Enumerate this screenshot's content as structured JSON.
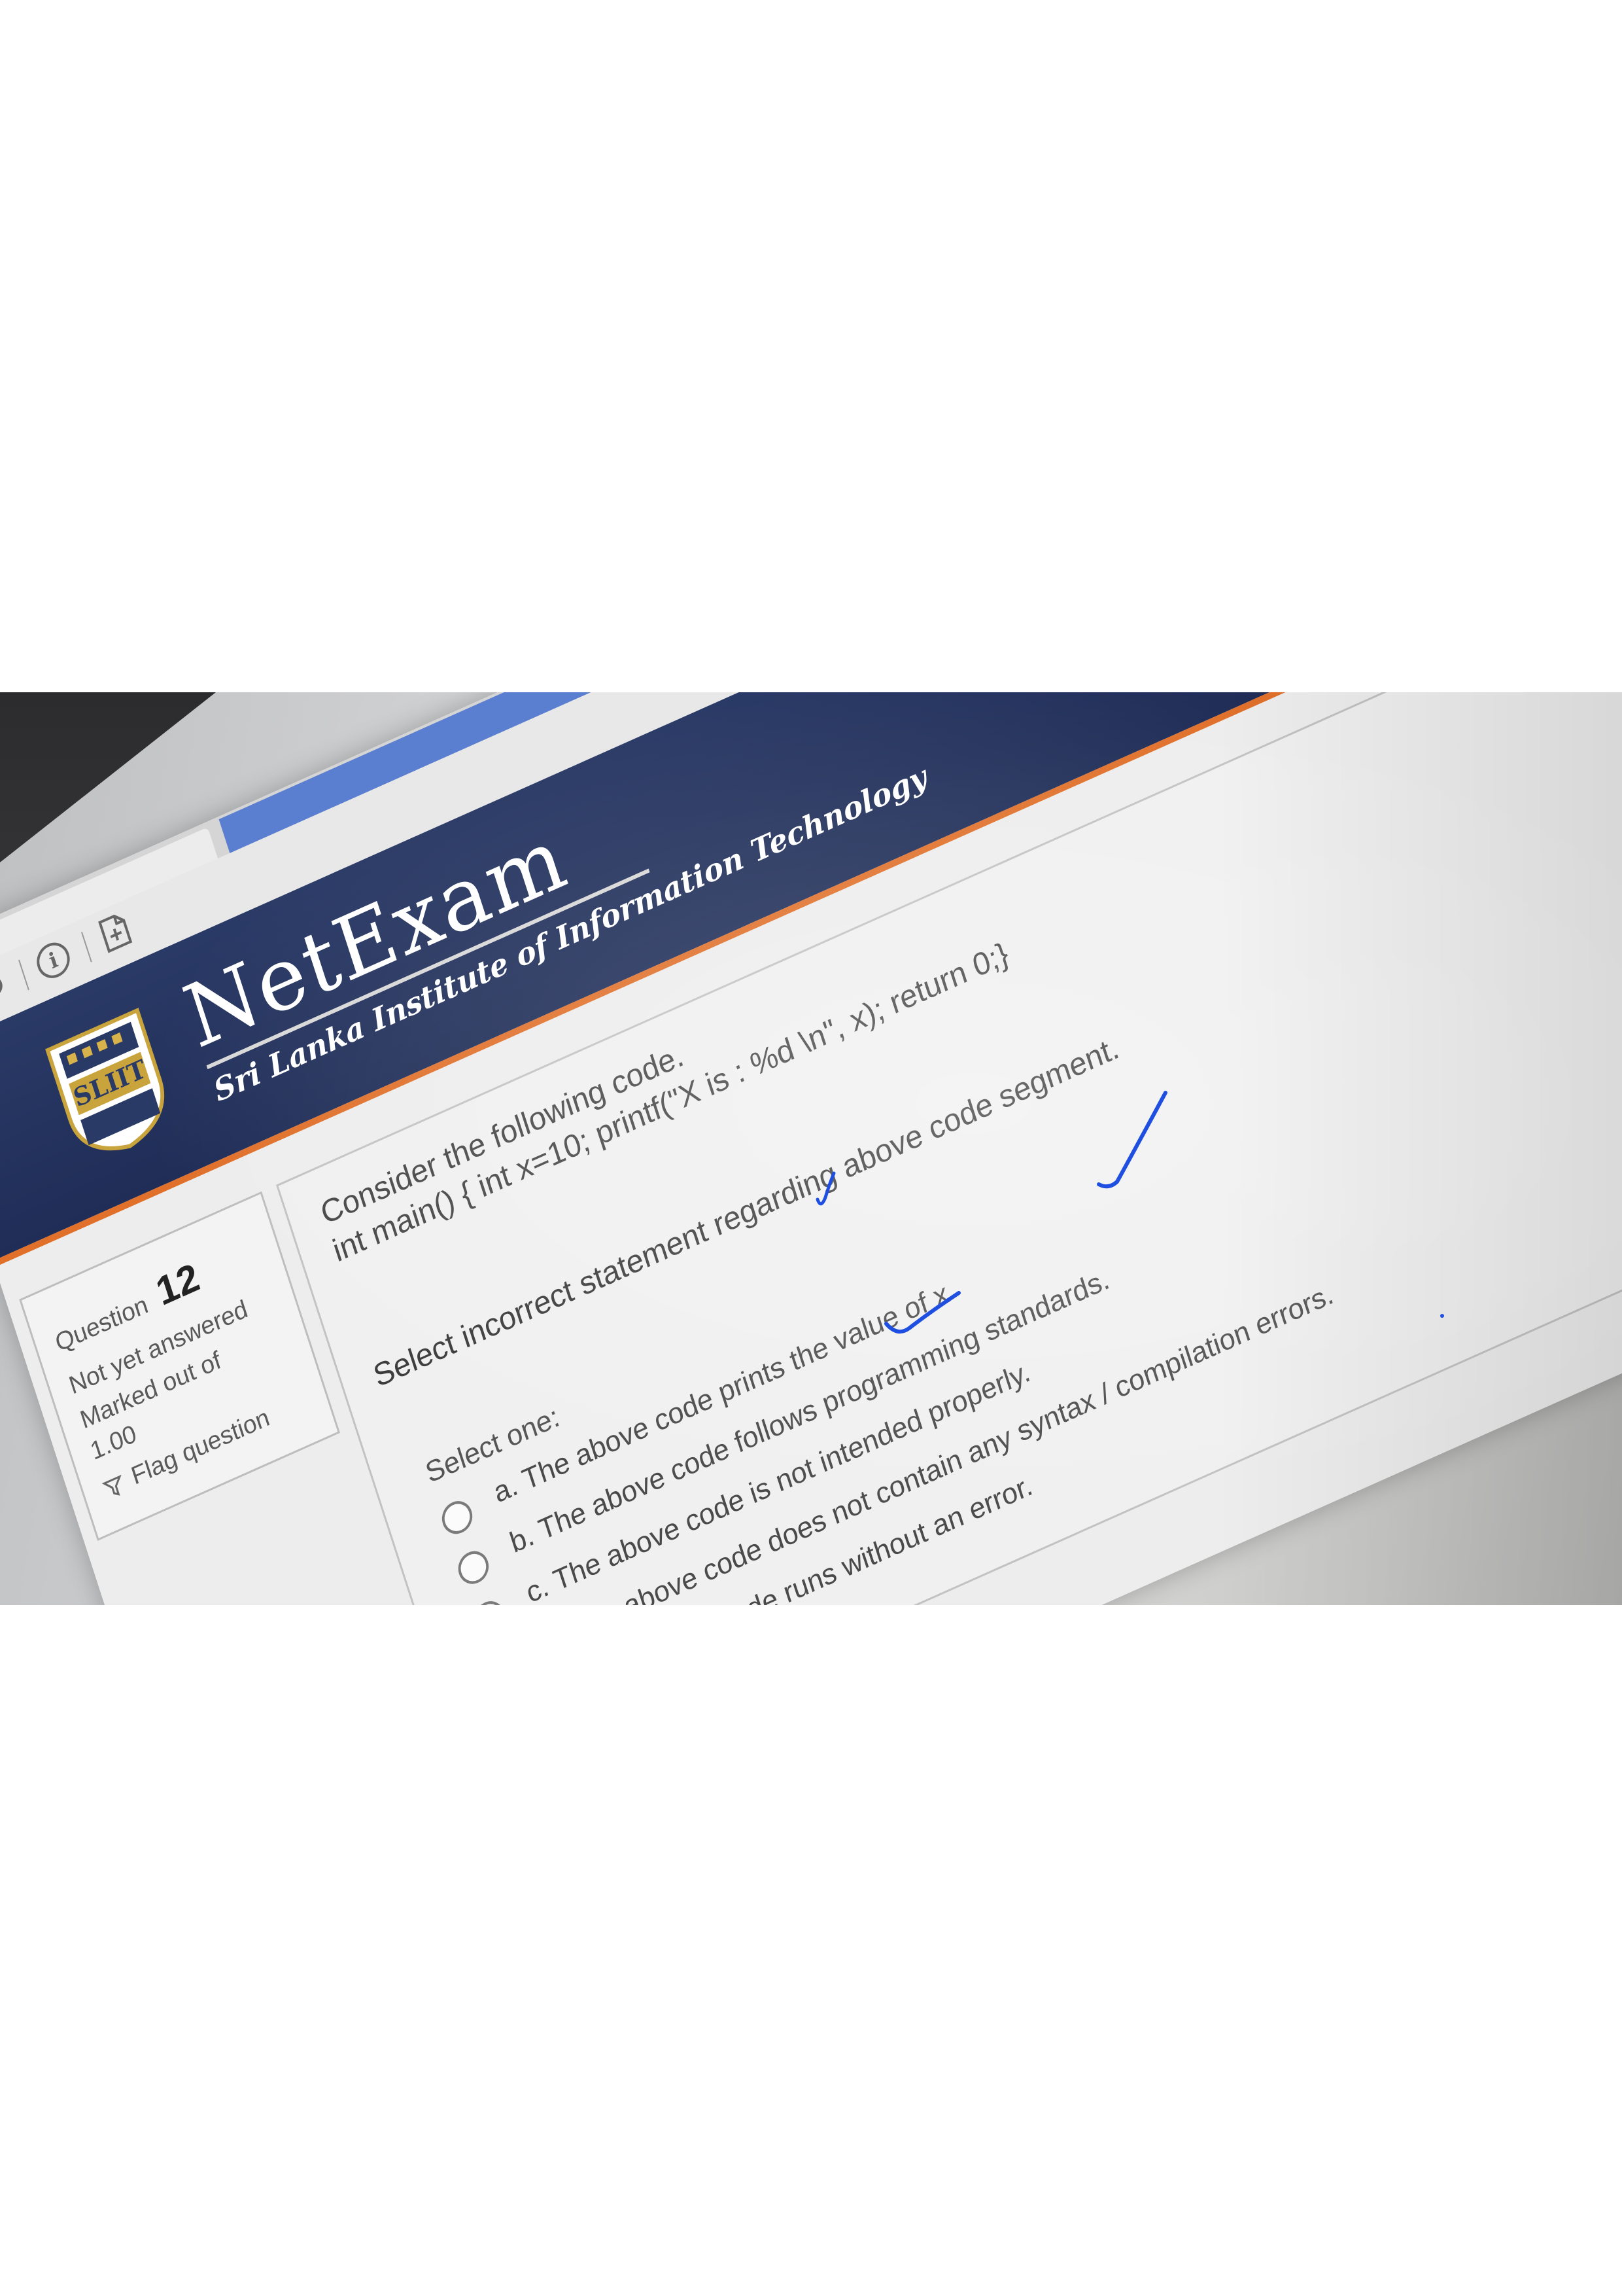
{
  "browser": {
    "tab_close_glyph": "×",
    "stop_glyph": "×",
    "reload_glyph": "↻",
    "info_glyph": "i"
  },
  "header": {
    "title": "NetExam",
    "subtitle": "Sri Lanka Institute of Information Technology",
    "logo_text": "SLIIT"
  },
  "question_info": {
    "label": "Question",
    "number": "12",
    "status": "Not yet answered",
    "marked_out_of": "Marked out of",
    "mark_value": "1.00",
    "flag_label": "Flag question"
  },
  "question": {
    "line1": "Consider the following code.",
    "line2": "int main() { int x=10; printf(\"X is : %d \\n\", x); return 0;}",
    "prompt": "Select incorrect statement regarding above code segment.",
    "select_one": "Select one:",
    "options": [
      {
        "label": "a. The above code prints the value of x"
      },
      {
        "label": "b. The above code follows programming standards."
      },
      {
        "label": "c. The above code is not intended properly."
      },
      {
        "label": "d. The above code does not contain any syntax / compilation errors."
      },
      {
        "label": "e. The above code runs without an error."
      }
    ]
  },
  "colors": {
    "header_blue": "#1f2d57",
    "accent_orange": "#e0702a",
    "ink_blue": "#1f4fe0"
  },
  "annotations": [
    "checkmark-icon",
    "checkmark-icon",
    "checkmark-icon"
  ]
}
